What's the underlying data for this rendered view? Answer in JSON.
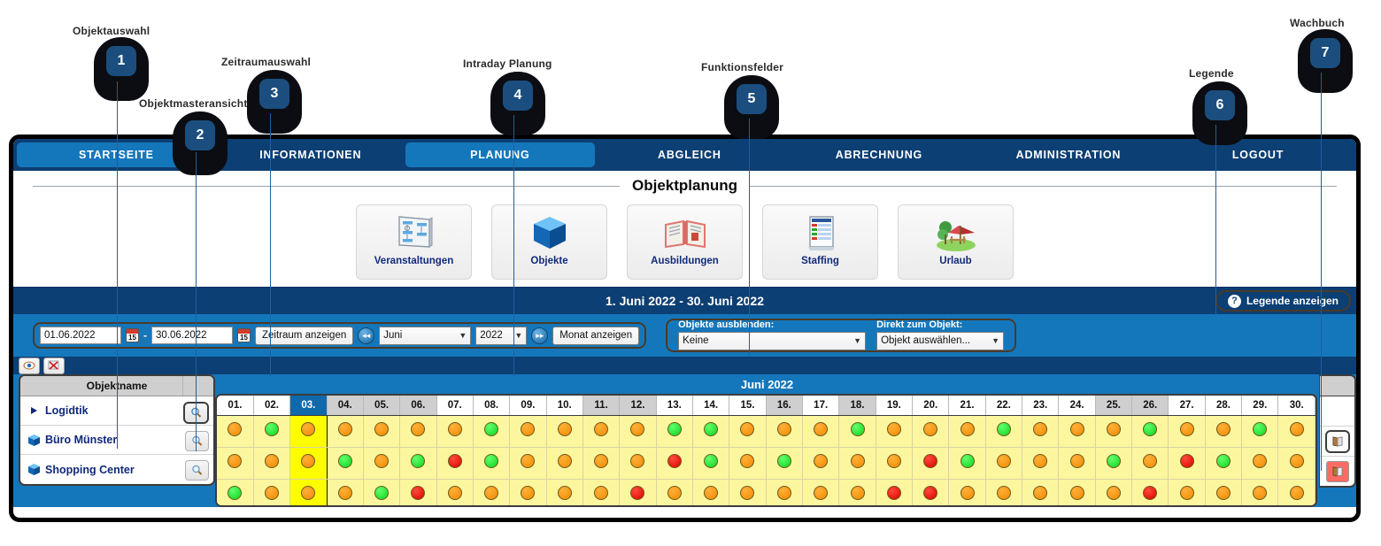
{
  "annotations": [
    {
      "num": "1",
      "label": "Objektauswahl"
    },
    {
      "num": "2",
      "label": "Objektmasteransicht"
    },
    {
      "num": "3",
      "label": "Zeitraumauswahl"
    },
    {
      "num": "4",
      "label": "Intraday Planung"
    },
    {
      "num": "5",
      "label": "Funktionsfelder"
    },
    {
      "num": "6",
      "label": "Legende"
    },
    {
      "num": "7",
      "label": "Wachbuch"
    }
  ],
  "nav": {
    "items": [
      {
        "label": "STARTSEITE",
        "active": true
      },
      {
        "label": "INFORMATIONEN",
        "active": false
      },
      {
        "label": "PLANUNG",
        "active": true
      },
      {
        "label": "ABGLEICH",
        "active": false
      },
      {
        "label": "ABRECHNUNG",
        "active": false
      },
      {
        "label": "ADMINISTRATION",
        "active": false
      },
      {
        "label": "LOGOUT",
        "active": false
      }
    ]
  },
  "section": {
    "title": "Objektplanung"
  },
  "tiles": [
    {
      "label": "Veranstaltungen",
      "icon": "presentation-board-icon"
    },
    {
      "label": "Objekte",
      "icon": "blue-cube-icon"
    },
    {
      "label": "Ausbildungen",
      "icon": "open-book-icon"
    },
    {
      "label": "Staffing",
      "icon": "document-chart-icon"
    },
    {
      "label": "Urlaub",
      "icon": "vacation-parasol-icon"
    }
  ],
  "daterange": {
    "title": "1. Juni 2022 - 30. Juni 2022",
    "legend_button": "Legende anzeigen",
    "legend_icon": "question-mark-icon"
  },
  "controls": {
    "date_from": "01.06.2022",
    "date_to": "30.06.2022",
    "separator": "-",
    "calendar_icon_day": "15",
    "show_period_button": "Zeitraum anzeigen",
    "prev_icon": "double-chevron-left-icon",
    "next_icon": "double-chevron-right-icon",
    "month_value": "Juni",
    "year_value": "2022",
    "show_month_button": "Monat anzeigen",
    "hide_objects_label": "Objekte ausblenden:",
    "hide_objects_value": "Keine",
    "direct_object_label": "Direkt zum Objekt:",
    "direct_object_value": "Objekt auswählen..."
  },
  "minibar": {
    "eye_icon": "eye-icon",
    "clear_icon": "red-cross-clear-icon"
  },
  "grid": {
    "objectname_header": "Objektname",
    "month_header": "Juni 2022",
    "search_icon": "magnifier-icon",
    "book_icon": "wachbuch-book-icon",
    "rows": [
      {
        "name": "Logidtik",
        "icon": "triangle-expand-icon",
        "focused_search": true,
        "wachbuch": "none"
      },
      {
        "name": "Büro Münster",
        "icon": "blue-cube-icon",
        "focused_search": false,
        "wachbuch": "normal"
      },
      {
        "name": "Shopping Center",
        "icon": "blue-cube-icon",
        "focused_search": false,
        "wachbuch": "alert"
      }
    ]
  },
  "chart_data": {
    "type": "table",
    "title": "Objektplanung Juni 2022",
    "categories": [
      "01.",
      "02.",
      "03.",
      "04.",
      "05.",
      "06.",
      "07.",
      "08.",
      "09.",
      "10.",
      "11.",
      "12.",
      "13.",
      "14.",
      "15.",
      "16.",
      "17.",
      "18.",
      "19.",
      "20.",
      "21.",
      "22.",
      "23.",
      "24.",
      "25.",
      "26.",
      "27.",
      "28.",
      "29.",
      "30."
    ],
    "weekend_days": [
      "04.",
      "05.",
      "06.",
      "11.",
      "12.",
      "16.",
      "18.",
      "25.",
      "26."
    ],
    "today": "03.",
    "legend": [
      {
        "key": "o",
        "color": "#f08a00",
        "name": "orange"
      },
      {
        "key": "g",
        "color": "#0bd419",
        "name": "green"
      },
      {
        "key": "r",
        "color": "#da0000",
        "name": "red"
      }
    ],
    "series": [
      {
        "name": "Logidtik",
        "values": [
          "o",
          "g",
          "o",
          "o",
          "o",
          "o",
          "o",
          "g",
          "o",
          "o",
          "o",
          "o",
          "g",
          "g",
          "o",
          "o",
          "o",
          "g",
          "o",
          "o",
          "o",
          "g",
          "o",
          "o",
          "o",
          "g",
          "o",
          "o",
          "g",
          "o"
        ]
      },
      {
        "name": "Büro Münster",
        "values": [
          "o",
          "o",
          "o",
          "g",
          "o",
          "g",
          "r",
          "g",
          "o",
          "o",
          "o",
          "o",
          "r",
          "g",
          "o",
          "g",
          "o",
          "o",
          "o",
          "r",
          "g",
          "o",
          "o",
          "o",
          "g",
          "o",
          "r",
          "g",
          "o",
          "o"
        ]
      },
      {
        "name": "Shopping Center",
        "values": [
          "g",
          "o",
          "o",
          "o",
          "g",
          "r",
          "o",
          "o",
          "o",
          "o",
          "o",
          "r",
          "o",
          "o",
          "o",
          "o",
          "o",
          "o",
          "r",
          "r",
          "o",
          "o",
          "o",
          "o",
          "o",
          "r",
          "o",
          "o",
          "o",
          "o"
        ]
      }
    ]
  }
}
